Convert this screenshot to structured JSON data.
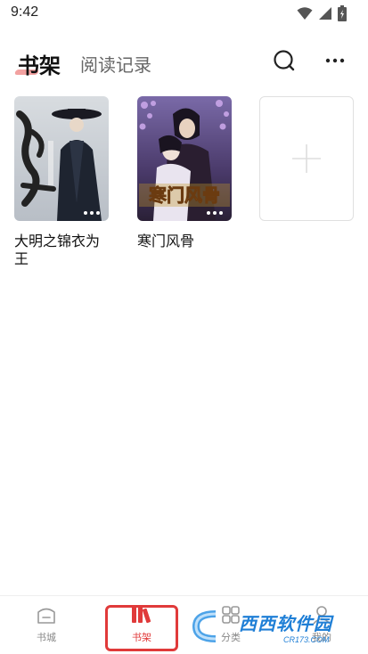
{
  "status_bar": {
    "time": "9:42"
  },
  "header": {
    "active_tab": "书架",
    "inactive_tab": "阅读记录",
    "accent_color": "#f2a1a0"
  },
  "books": [
    {
      "title": "大明之锦衣为王"
    },
    {
      "title": "寒门风骨"
    }
  ],
  "bottom_nav": {
    "items": [
      {
        "label": "书城",
        "icon": "bookstore-icon"
      },
      {
        "label": "书架",
        "icon": "bookshelf-icon",
        "active": true
      },
      {
        "label": "分类",
        "icon": "category-icon"
      },
      {
        "label": "我的",
        "icon": "profile-icon"
      }
    ],
    "active_color": "#e03a3a"
  },
  "watermark": {
    "main": "西西软件园",
    "sub": "CR173.COM"
  }
}
